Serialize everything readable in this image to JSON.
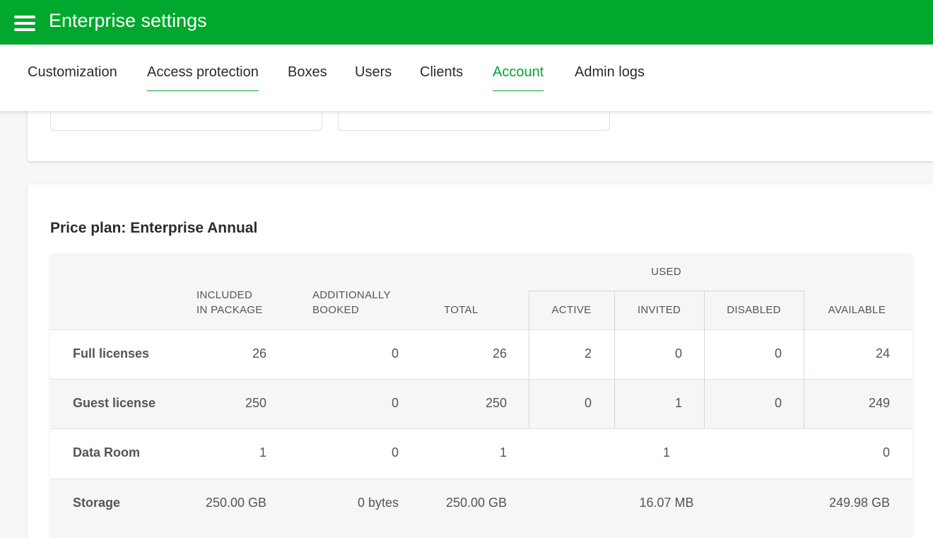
{
  "header": {
    "title": "Enterprise settings"
  },
  "tabs": [
    {
      "label": "Customization"
    },
    {
      "label": "Access protection"
    },
    {
      "label": "Boxes"
    },
    {
      "label": "Users"
    },
    {
      "label": "Clients"
    },
    {
      "label": "Account"
    },
    {
      "label": "Admin logs"
    }
  ],
  "active_tab": "Account",
  "colors": {
    "brand": "#00a82d"
  },
  "plan": {
    "title": "Price plan: Enterprise Annual"
  },
  "table": {
    "headers": {
      "included_1": "INCLUDED",
      "included_2": "IN PACKAGE",
      "additional_1": "ADDITIONALLY",
      "additional_2": "BOOKED",
      "total": "TOTAL",
      "used": "USED",
      "active": "ACTIVE",
      "invited": "INVITED",
      "disabled": "DISABLED",
      "available": "AVAILABLE"
    },
    "rows": [
      {
        "label": "Full licenses",
        "included": "26",
        "additional": "0",
        "total": "26",
        "active": "2",
        "invited": "0",
        "disabled": "0",
        "available": "24"
      },
      {
        "label": "Guest license",
        "included": "250",
        "additional": "0",
        "total": "250",
        "active": "0",
        "invited": "1",
        "disabled": "0",
        "available": "249"
      },
      {
        "label": "Data Room",
        "included": "1",
        "additional": "0",
        "total": "1",
        "used": "1",
        "available": "0"
      },
      {
        "label": "Storage",
        "included": "250.00 GB",
        "additional": "0 bytes",
        "total": "250.00 GB",
        "used": "16.07 MB",
        "available": "249.98 GB"
      }
    ]
  }
}
